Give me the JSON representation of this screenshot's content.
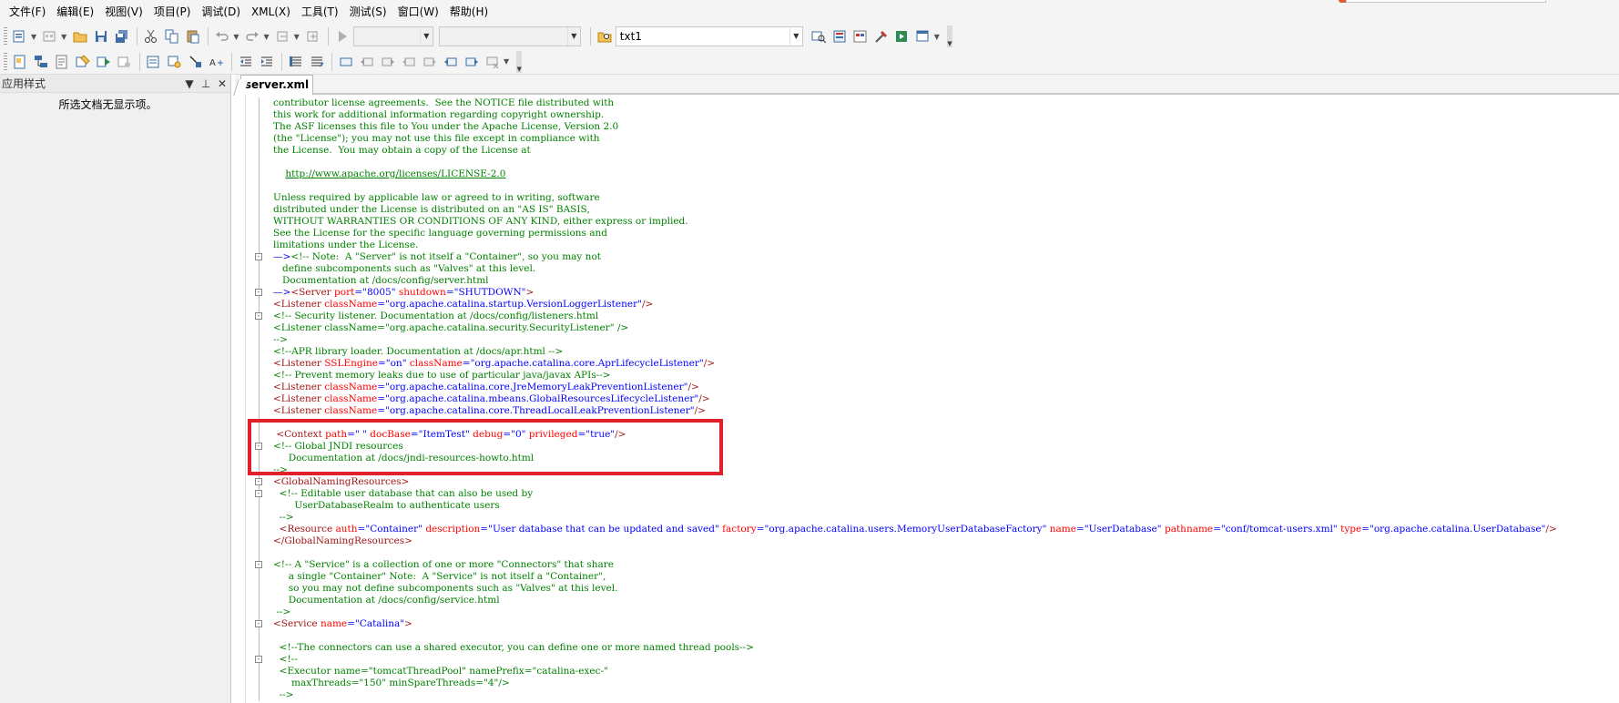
{
  "menu": {
    "items": [
      "文件(F)",
      "编辑(E)",
      "视图(V)",
      "项目(P)",
      "调试(D)",
      "XML(X)",
      "工具(T)",
      "测试(S)",
      "窗口(W)",
      "帮助(H)"
    ]
  },
  "toolbar": {
    "config_combo_value": "",
    "platform_combo_value": "",
    "find_combo_value": "txt1"
  },
  "left_panel": {
    "title": "应用样式",
    "empty_message": "所选文档无显示项。"
  },
  "editor": {
    "tab_label": "server.xml",
    "lines": [
      {
        "fold": "",
        "segs": [
          {
            "c": "c",
            "t": "contributor license agreements.  See the NOTICE file distributed with"
          }
        ]
      },
      {
        "fold": "",
        "segs": [
          {
            "c": "c",
            "t": "this work for additional information regarding copyright ownership."
          }
        ]
      },
      {
        "fold": "",
        "segs": [
          {
            "c": "c",
            "t": "The ASF licenses this file to You under the Apache License, Version 2.0"
          }
        ]
      },
      {
        "fold": "",
        "segs": [
          {
            "c": "c",
            "t": "(the \"License\"); you may not use this file except in compliance with"
          }
        ]
      },
      {
        "fold": "",
        "segs": [
          {
            "c": "c",
            "t": "the License.  You may obtain a copy of the License at"
          }
        ]
      },
      {
        "fold": "",
        "segs": []
      },
      {
        "fold": "",
        "segs": [
          {
            "c": "c",
            "t": "    "
          },
          {
            "c": "u",
            "t": "http://www.apache.org/licenses/LICENSE-2.0"
          }
        ]
      },
      {
        "fold": "",
        "segs": []
      },
      {
        "fold": "",
        "segs": [
          {
            "c": "c",
            "t": "Unless required by applicable law or agreed to in writing, software"
          }
        ]
      },
      {
        "fold": "",
        "segs": [
          {
            "c": "c",
            "t": "distributed under the License is distributed on an \"AS IS\" BASIS,"
          }
        ]
      },
      {
        "fold": "",
        "segs": [
          {
            "c": "c",
            "t": "WITHOUT WARRANTIES OR CONDITIONS OF ANY KIND, either express or implied."
          }
        ]
      },
      {
        "fold": "",
        "segs": [
          {
            "c": "c",
            "t": "See the License for the specific language governing permissions and"
          }
        ]
      },
      {
        "fold": "",
        "segs": [
          {
            "c": "c",
            "t": "limitations under the License."
          }
        ]
      },
      {
        "fold": "-",
        "segs": [
          {
            "c": "k",
            "t": "—>"
          },
          {
            "c": "c",
            "t": "<!-- Note:  A \"Server\" is not itself a \"Container\", so you may not"
          }
        ]
      },
      {
        "fold": "",
        "segs": [
          {
            "c": "c",
            "t": "   define subcomponents such as \"Valves\" at this level."
          }
        ]
      },
      {
        "fold": "",
        "segs": [
          {
            "c": "c",
            "t": "   Documentation at /docs/config/server.html"
          }
        ]
      },
      {
        "fold": "-",
        "segs": [
          {
            "c": "k",
            "t": "—>"
          },
          {
            "c": "t",
            "t": "<Server "
          },
          {
            "c": "a",
            "t": "port"
          },
          {
            "c": "k",
            "t": "="
          },
          {
            "c": "v",
            "t": "\"8005\""
          },
          {
            "c": "a",
            "t": " shutdown"
          },
          {
            "c": "k",
            "t": "="
          },
          {
            "c": "v",
            "t": "\"SHUTDOWN\""
          },
          {
            "c": "t",
            "t": ">"
          }
        ]
      },
      {
        "fold": "",
        "segs": [
          {
            "c": "t",
            "t": "<Listener "
          },
          {
            "c": "a",
            "t": "className"
          },
          {
            "c": "k",
            "t": "="
          },
          {
            "c": "v",
            "t": "\"org.apache.catalina.startup.VersionLoggerListener\""
          },
          {
            "c": "t",
            "t": "/>"
          }
        ]
      },
      {
        "fold": "-",
        "segs": [
          {
            "c": "c",
            "t": "<!-- Security listener. Documentation at /docs/config/listeners.html"
          }
        ]
      },
      {
        "fold": "",
        "segs": [
          {
            "c": "c",
            "t": "<Listener className=\"org.apache.catalina.security.SecurityListener\" />"
          }
        ]
      },
      {
        "fold": "",
        "segs": [
          {
            "c": "c",
            "t": "-->"
          }
        ]
      },
      {
        "fold": "",
        "segs": [
          {
            "c": "c",
            "t": "<!--APR library loader. Documentation at /docs/apr.html -->"
          }
        ]
      },
      {
        "fold": "",
        "segs": [
          {
            "c": "t",
            "t": "<Listener "
          },
          {
            "c": "a",
            "t": "SSLEngine"
          },
          {
            "c": "k",
            "t": "="
          },
          {
            "c": "v",
            "t": "\"on\""
          },
          {
            "c": "a",
            "t": " className"
          },
          {
            "c": "k",
            "t": "="
          },
          {
            "c": "v",
            "t": "\"org.apache.catalina.core.AprLifecycleListener\""
          },
          {
            "c": "t",
            "t": "/>"
          }
        ]
      },
      {
        "fold": "",
        "segs": [
          {
            "c": "c",
            "t": "<!-- Prevent memory leaks due to use of particular java/javax APIs-->"
          }
        ]
      },
      {
        "fold": "",
        "segs": [
          {
            "c": "t",
            "t": "<Listener "
          },
          {
            "c": "a",
            "t": "className"
          },
          {
            "c": "k",
            "t": "="
          },
          {
            "c": "v",
            "t": "\"org.apache.catalina.core.JreMemoryLeakPreventionListener\""
          },
          {
            "c": "t",
            "t": "/>"
          }
        ]
      },
      {
        "fold": "",
        "segs": [
          {
            "c": "t",
            "t": "<Listener "
          },
          {
            "c": "a",
            "t": "className"
          },
          {
            "c": "k",
            "t": "="
          },
          {
            "c": "v",
            "t": "\"org.apache.catalina.mbeans.GlobalResourcesLifecycleListener\""
          },
          {
            "c": "t",
            "t": "/>"
          }
        ]
      },
      {
        "fold": "",
        "segs": [
          {
            "c": "t",
            "t": "<Listener "
          },
          {
            "c": "a",
            "t": "className"
          },
          {
            "c": "k",
            "t": "="
          },
          {
            "c": "v",
            "t": "\"org.apache.catalina.core.ThreadLocalLeakPreventionListener\""
          },
          {
            "c": "t",
            "t": "/>"
          }
        ]
      },
      {
        "fold": "",
        "segs": []
      },
      {
        "fold": "",
        "segs": [
          {
            "c": "t",
            "t": " <Context "
          },
          {
            "c": "a",
            "t": "path"
          },
          {
            "c": "k",
            "t": "="
          },
          {
            "c": "v",
            "t": "\" \""
          },
          {
            "c": "a",
            "t": " docBase"
          },
          {
            "c": "k",
            "t": "="
          },
          {
            "c": "v",
            "t": "\"ItemTest\""
          },
          {
            "c": "a",
            "t": " debug"
          },
          {
            "c": "k",
            "t": "="
          },
          {
            "c": "v",
            "t": "\"0\""
          },
          {
            "c": "a",
            "t": " privileged"
          },
          {
            "c": "k",
            "t": "="
          },
          {
            "c": "v",
            "t": "\"true\""
          },
          {
            "c": "t",
            "t": "/>"
          }
        ]
      },
      {
        "fold": "-",
        "segs": [
          {
            "c": "c",
            "t": "<!-- Global JNDI resources"
          }
        ]
      },
      {
        "fold": "",
        "segs": [
          {
            "c": "c",
            "t": "     Documentation at /docs/jndi-resources-howto.html"
          }
        ]
      },
      {
        "fold": "",
        "segs": [
          {
            "c": "c",
            "t": "-->"
          }
        ]
      },
      {
        "fold": "-",
        "segs": [
          {
            "c": "t",
            "t": "<GlobalNamingResources>"
          }
        ]
      },
      {
        "fold": "-",
        "segs": [
          {
            "c": "c",
            "t": "  <!-- Editable user database that can also be used by"
          }
        ]
      },
      {
        "fold": "",
        "segs": [
          {
            "c": "c",
            "t": "       UserDatabaseRealm to authenticate users"
          }
        ]
      },
      {
        "fold": "",
        "segs": [
          {
            "c": "c",
            "t": "  -->"
          }
        ]
      },
      {
        "fold": "",
        "segs": [
          {
            "c": "t",
            "t": "  <Resource "
          },
          {
            "c": "a",
            "t": "auth"
          },
          {
            "c": "k",
            "t": "="
          },
          {
            "c": "v",
            "t": "\"Container\""
          },
          {
            "c": "a",
            "t": " description"
          },
          {
            "c": "k",
            "t": "="
          },
          {
            "c": "v",
            "t": "\"User database that can be updated and saved\""
          },
          {
            "c": "a",
            "t": " factory"
          },
          {
            "c": "k",
            "t": "="
          },
          {
            "c": "v",
            "t": "\"org.apache.catalina.users.MemoryUserDatabaseFactory\""
          },
          {
            "c": "a",
            "t": " name"
          },
          {
            "c": "k",
            "t": "="
          },
          {
            "c": "v",
            "t": "\"UserDatabase\""
          },
          {
            "c": "a",
            "t": " pathname"
          },
          {
            "c": "k",
            "t": "="
          },
          {
            "c": "v",
            "t": "\"conf/tomcat-users.xml\""
          },
          {
            "c": "a",
            "t": " type"
          },
          {
            "c": "k",
            "t": "="
          },
          {
            "c": "v",
            "t": "\"org.apache.catalina.UserDatabase\""
          },
          {
            "c": "t",
            "t": "/>"
          }
        ]
      },
      {
        "fold": "",
        "segs": [
          {
            "c": "t",
            "t": "</GlobalNamingResources>"
          }
        ]
      },
      {
        "fold": "",
        "segs": []
      },
      {
        "fold": "-",
        "segs": [
          {
            "c": "c",
            "t": "<!-- A \"Service\" is a collection of one or more \"Connectors\" that share"
          }
        ]
      },
      {
        "fold": "",
        "segs": [
          {
            "c": "c",
            "t": "     a single \"Container\" Note:  A \"Service\" is not itself a \"Container\","
          }
        ]
      },
      {
        "fold": "",
        "segs": [
          {
            "c": "c",
            "t": "     so you may not define subcomponents such as \"Valves\" at this level."
          }
        ]
      },
      {
        "fold": "",
        "segs": [
          {
            "c": "c",
            "t": "     Documentation at /docs/config/service.html"
          }
        ]
      },
      {
        "fold": "",
        "segs": [
          {
            "c": "c",
            "t": " -->"
          }
        ]
      },
      {
        "fold": "-",
        "segs": [
          {
            "c": "t",
            "t": "<Service "
          },
          {
            "c": "a",
            "t": "name"
          },
          {
            "c": "k",
            "t": "="
          },
          {
            "c": "v",
            "t": "\"Catalina\""
          },
          {
            "c": "t",
            "t": ">"
          }
        ]
      },
      {
        "fold": "",
        "segs": []
      },
      {
        "fold": "",
        "segs": [
          {
            "c": "c",
            "t": "  <!--The connectors can use a shared executor, you can define one or more named thread pools-->"
          }
        ]
      },
      {
        "fold": "-",
        "segs": [
          {
            "c": "c",
            "t": "  <!--"
          }
        ]
      },
      {
        "fold": "",
        "segs": [
          {
            "c": "c",
            "t": "  <Executor name=\"tomcatThreadPool\" namePrefix=\"catalina-exec-\""
          }
        ]
      },
      {
        "fold": "",
        "segs": [
          {
            "c": "c",
            "t": "      maxThreads=\"150\" minSpareThreads=\"4\"/>"
          }
        ]
      },
      {
        "fold": "",
        "segs": [
          {
            "c": "c",
            "t": "  -->"
          }
        ]
      }
    ]
  },
  "colors": {
    "comment": "#008000",
    "tag": "#a31515",
    "attribute": "#ff0000",
    "value": "#0000ff",
    "highlight_box": "#e0202a"
  }
}
